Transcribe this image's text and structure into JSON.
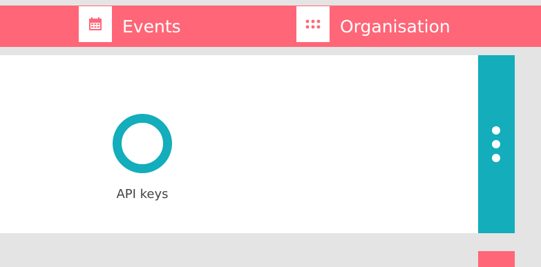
{
  "nav": {
    "events": {
      "label": "Events",
      "icon": "calendar-icon"
    },
    "organisation": {
      "label": "Organisation",
      "icon": "grid-dots-icon"
    }
  },
  "apps": [
    {
      "label": "API keys",
      "icon": "ring-icon"
    }
  ],
  "card_menu": {
    "icon": "more-vertical-icon"
  },
  "colors": {
    "nav_bg": "#ff6677",
    "accent": "#13adbb",
    "page_bg": "#e4e4e4",
    "card_bg": "#ffffff",
    "text": "#444444"
  }
}
